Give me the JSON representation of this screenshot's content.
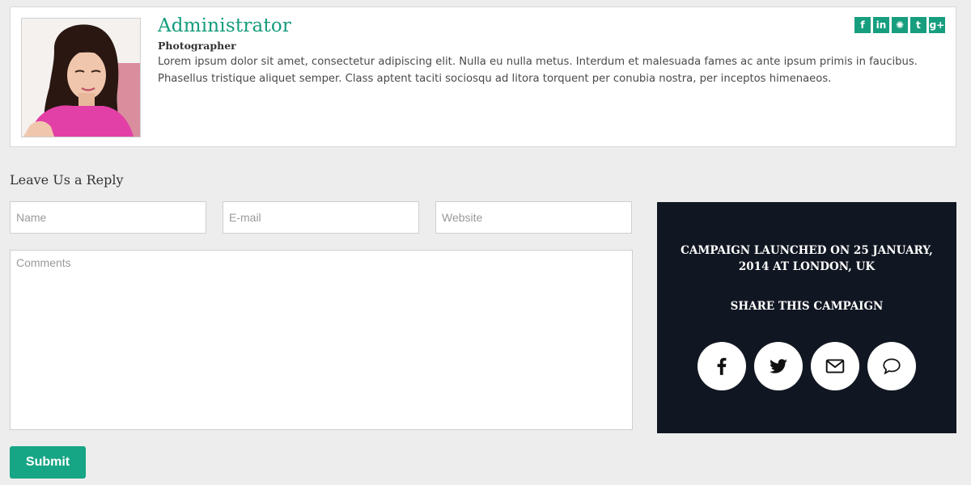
{
  "author": {
    "name": "Administrator",
    "role": "Photographer",
    "bio": "Lorem ipsum dolor sit amet, consectetur adipiscing elit. Nulla eu nulla metus. Interdum et malesuada fames ac ante ipsum primis in faucibus. Phasellus tristique aliquet semper. Class aptent taciti sociosqu ad litora torquent per conubia nostra, per inceptos himenaeos.",
    "social_links": [
      {
        "icon": "facebook-icon",
        "glyph": "f"
      },
      {
        "icon": "linkedin-icon",
        "glyph": "in"
      },
      {
        "icon": "dribbble-icon",
        "glyph": "✺"
      },
      {
        "icon": "twitter-icon",
        "glyph": "t"
      },
      {
        "icon": "google-plus-icon",
        "glyph": "g+"
      }
    ]
  },
  "reply_form": {
    "title": "Leave Us a Reply",
    "name_placeholder": "Name",
    "email_placeholder": "E-mail",
    "website_placeholder": "Website",
    "comments_placeholder": "Comments",
    "submit_label": "Submit"
  },
  "campaign": {
    "info": "Campaign launched on 25 January, 2014 at London, UK",
    "share_title": "Share this campaign",
    "share_icons": [
      "facebook-icon",
      "twitter-icon",
      "envelope-icon",
      "comment-icon"
    ]
  },
  "colors": {
    "accent": "#16a585",
    "panel_background": "#111722",
    "page_background": "#ededed"
  }
}
